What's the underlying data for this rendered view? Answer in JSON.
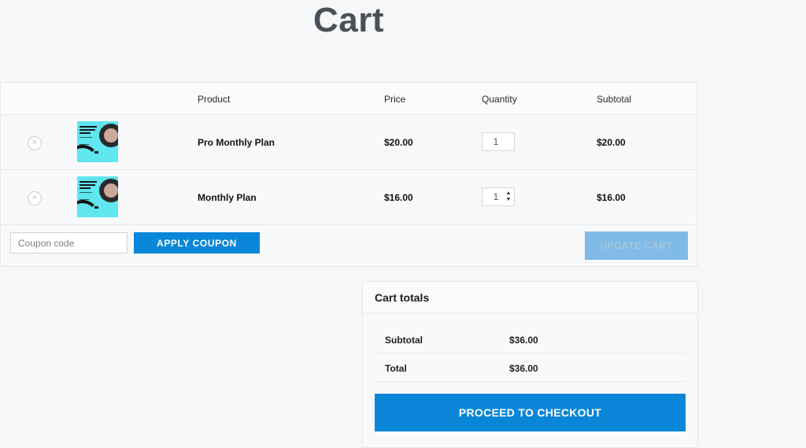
{
  "page": {
    "title": "Cart"
  },
  "table": {
    "headers": {
      "product": "Product",
      "price": "Price",
      "quantity": "Quantity",
      "subtotal": "Subtotal"
    },
    "items": [
      {
        "name": "Pro Monthly Plan",
        "price": "$20.00",
        "quantity": "1",
        "subtotal": "$20.00",
        "remove_symbol": "×",
        "thumbnail_icon": "plan-thumbnail-icon"
      },
      {
        "name": "Monthly Plan",
        "price": "$16.00",
        "quantity": "1",
        "subtotal": "$16.00",
        "remove_symbol": "×",
        "thumbnail_icon": "plan-thumbnail-icon"
      }
    ],
    "coupon": {
      "placeholder": "Coupon code",
      "value": "",
      "apply_label": "APPLY COUPON"
    },
    "update_label": "UPDATE CART"
  },
  "totals": {
    "title": "Cart totals",
    "subtotal_label": "Subtotal",
    "subtotal_value": "$36.00",
    "total_label": "Total",
    "total_value": "$36.00",
    "checkout_label": "PROCEED TO CHECKOUT"
  },
  "colors": {
    "accent": "#0a86d8",
    "accent_disabled": "#7fbbe6",
    "thumbnail_bg": "#5fe6ef",
    "title": "#4b4f58"
  }
}
